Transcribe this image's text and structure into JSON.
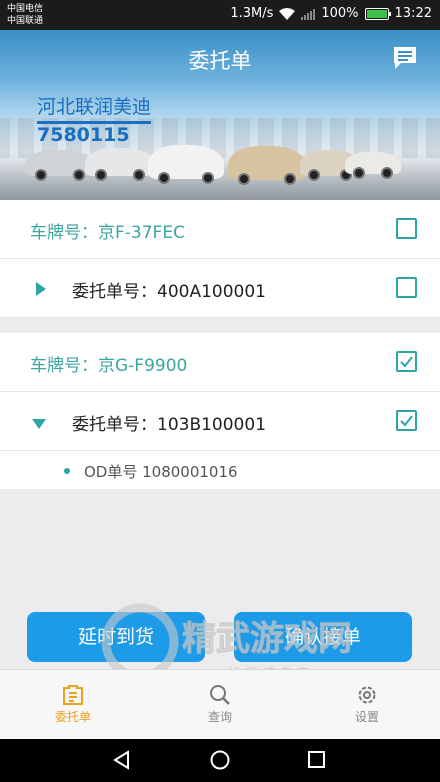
{
  "status_bar": {
    "carrier_1": "中国电信",
    "carrier_2": "中国联通",
    "speed": "1.3M/s",
    "battery": "100%",
    "time": "13:22"
  },
  "header": {
    "title": "委托单",
    "company_name": "河北联润美迪",
    "company_code": "7580115",
    "message_icon": "message-icon"
  },
  "groups": [
    {
      "plate_label": "车牌号：京F-37FEC",
      "plate_checked": false,
      "order_label": "委托单号：400A100001",
      "order_checked": false,
      "expanded": false
    },
    {
      "plate_label": "车牌号：京G-F9900",
      "plate_checked": true,
      "order_label": "委托单号：103B100001",
      "order_checked": true,
      "expanded": true,
      "od_label": "OD单号 1080001016"
    }
  ],
  "actions": {
    "delay_label": "延时到货",
    "confirm_label": "确认接单"
  },
  "watermark": {
    "brand": "精武游戏网",
    "tagline": "排 行 榜 专 家"
  },
  "tabs": [
    {
      "label": "委托单",
      "icon": "document-icon",
      "active": true
    },
    {
      "label": "查询",
      "icon": "search-icon",
      "active": false
    },
    {
      "label": "设置",
      "icon": "gear-icon",
      "active": false
    }
  ],
  "colors": {
    "accent": "#2aa7a4",
    "button": "#1e9be8",
    "active_tab": "#e9a21e",
    "company_text": "#1a6fc0"
  }
}
